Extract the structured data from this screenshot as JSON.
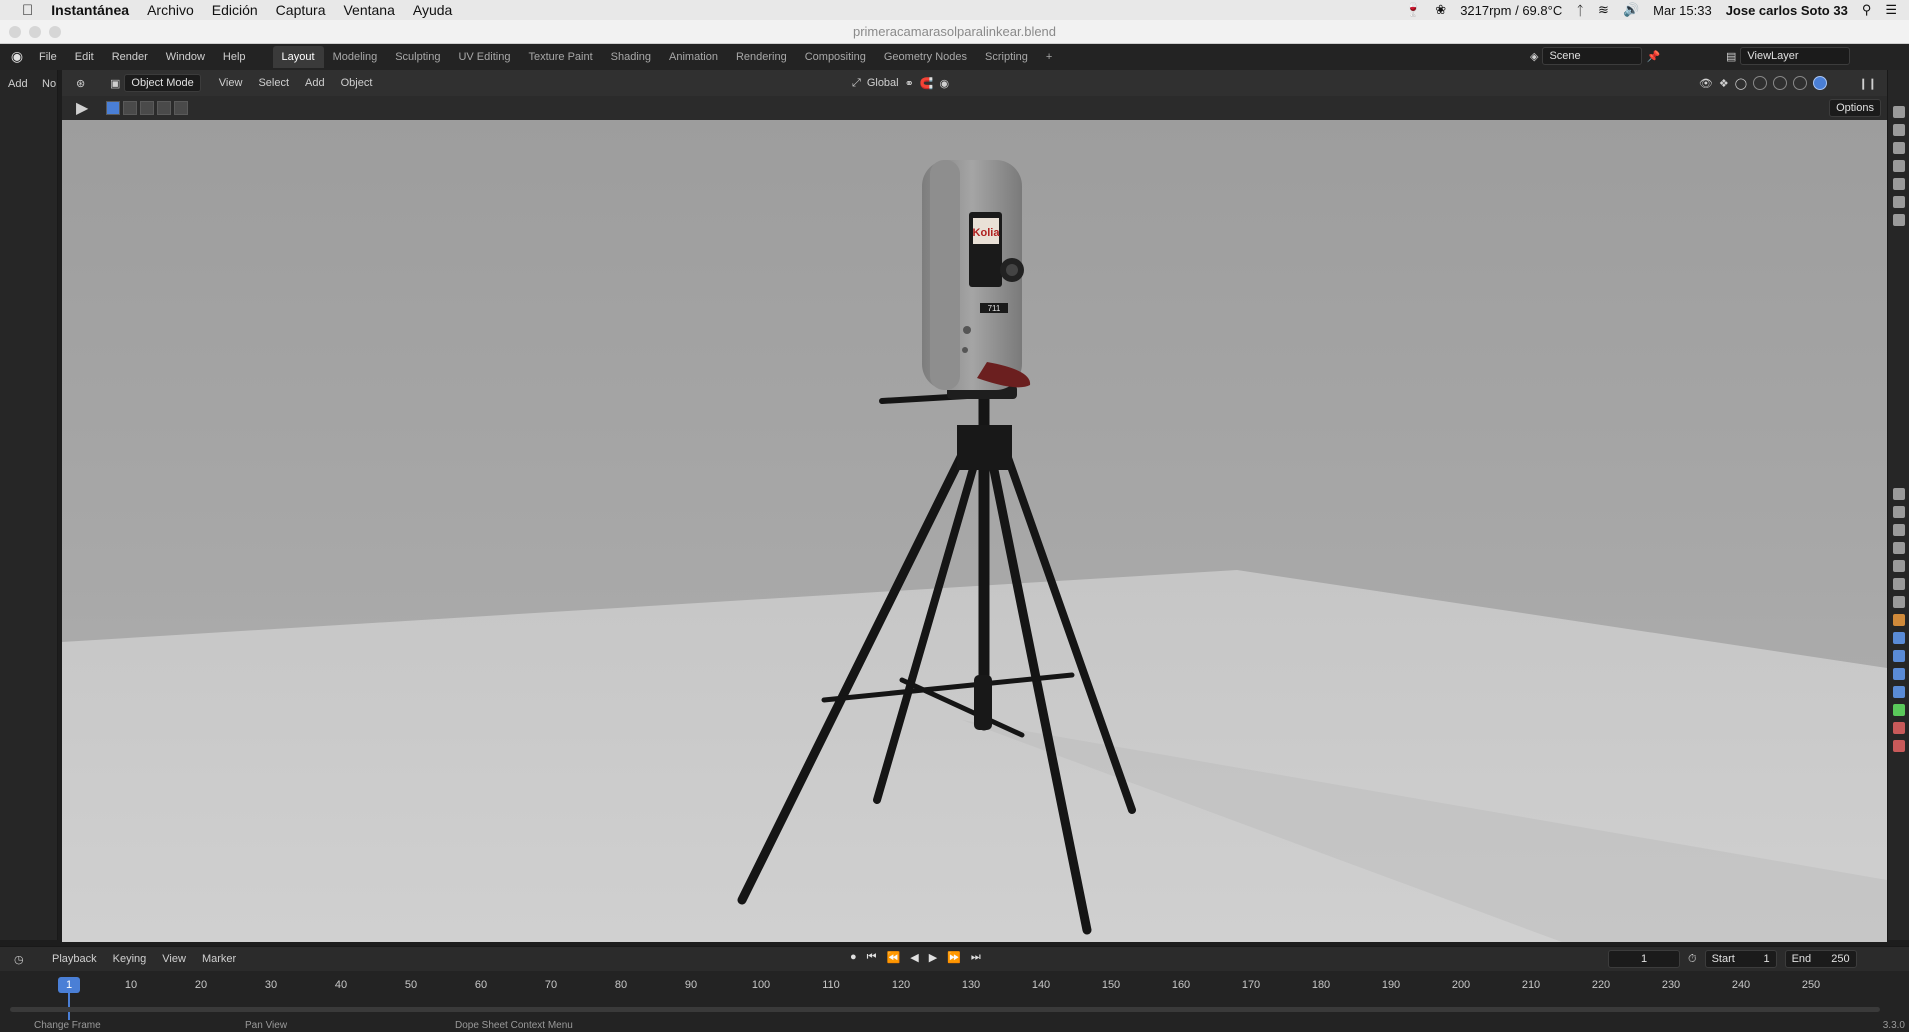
{
  "mac_menubar": {
    "app_name": "Instantánea",
    "menus": [
      "Archivo",
      "Edición",
      "Captura",
      "Ventana",
      "Ayuda"
    ],
    "status": "3217rpm / 69.8°C",
    "clock": "Mar 15:33",
    "user": "Jose carlos Soto 33"
  },
  "window": {
    "title": "primeracamarasolparalinkear.blend"
  },
  "blender_topbar": {
    "menus": [
      "File",
      "Edit",
      "Render",
      "Window",
      "Help"
    ],
    "workspaces": [
      "Layout",
      "Modeling",
      "Sculpting",
      "UV Editing",
      "Texture Paint",
      "Shading",
      "Animation",
      "Rendering",
      "Compositing",
      "Geometry Nodes",
      "Scripting"
    ],
    "active_workspace": "Layout",
    "add_tab": "+",
    "scene": "Scene",
    "view_layer": "ViewLayer"
  },
  "left_strip": {
    "add_label": "Add",
    "no_label": "No"
  },
  "viewport_header": {
    "mode": "Object Mode",
    "menus": [
      "View",
      "Select",
      "Add",
      "Object"
    ],
    "orientation": "Global",
    "options_label": "Options"
  },
  "viewport": {
    "camera_brand": "Kolia",
    "camera_model": "711"
  },
  "timeline": {
    "menus": [
      "Playback",
      "Keying",
      "View",
      "Marker"
    ],
    "current_frame": "1",
    "start_label": "Start",
    "start_value": "1",
    "end_label": "End",
    "end_value": "250",
    "ticks": [
      "10",
      "20",
      "30",
      "40",
      "50",
      "60",
      "70",
      "80",
      "90",
      "100",
      "110",
      "120",
      "130",
      "140",
      "150",
      "160",
      "170",
      "180",
      "190",
      "200",
      "210",
      "220",
      "230",
      "240",
      "250"
    ]
  },
  "statusbar": {
    "items": [
      "Change Frame",
      "Pan View",
      "Dope Sheet Context Menu"
    ],
    "version": "3.3.0"
  },
  "colors": {
    "accent": "#4a7fd6",
    "panel": "#232323",
    "viewport_bg": "#a3a3a3",
    "floor": "#c9c9c9"
  }
}
